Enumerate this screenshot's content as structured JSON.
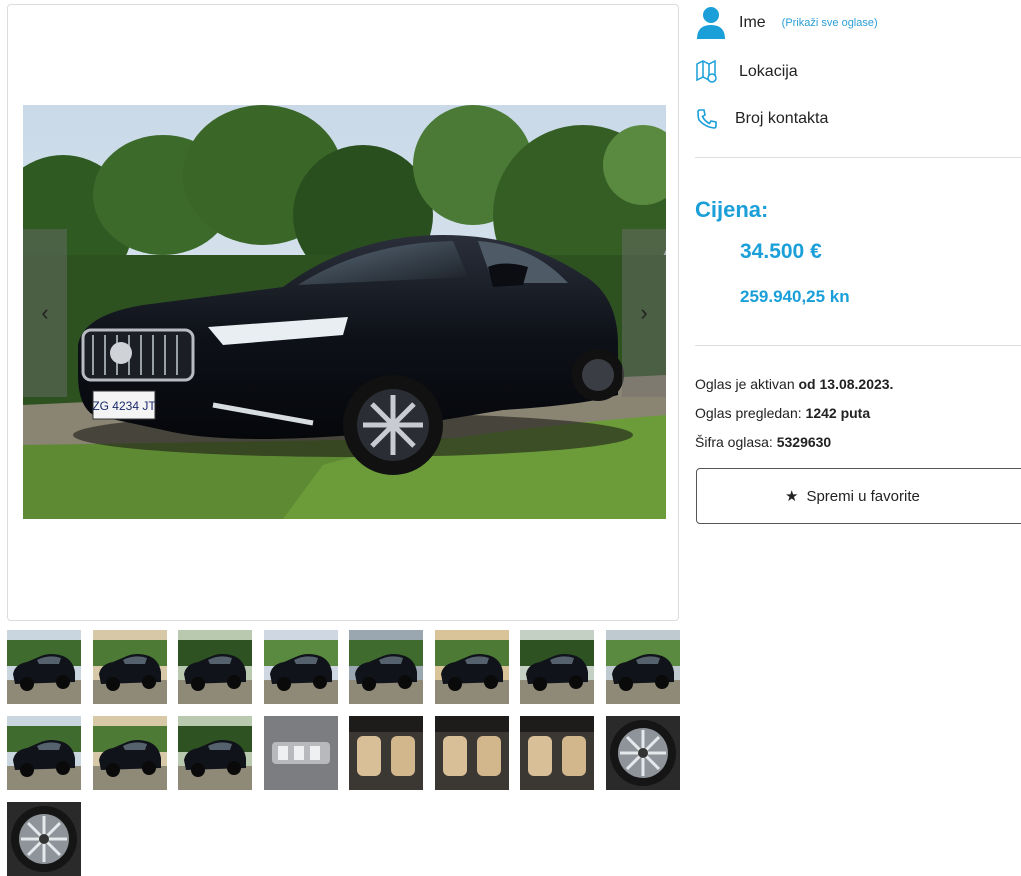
{
  "seller": {
    "name": "Ime",
    "all_ads_link": "(Prikaži sve oglase)",
    "location_label": "Lokacija",
    "phone_label": "Broj kontakta"
  },
  "price": {
    "label": "Cijena:",
    "eur": "34.500 €",
    "kn": "259.940,25 kn"
  },
  "ad": {
    "active_prefix": "Oglas je aktivan ",
    "active_value": "od 13.08.2023.",
    "views_prefix": "Oglas pregledan: ",
    "views_value": "1242 puta",
    "code_prefix": "Šifra oglasa: ",
    "code_value": "5329630"
  },
  "actions": {
    "favorite_label": "Spremi u favorite"
  },
  "gallery": {
    "prev_arrow": "‹",
    "next_arrow": "›",
    "plate_text": "ZG 4234 JT",
    "thumb_count": 17,
    "thumb_kinds": [
      "car",
      "car",
      "car",
      "car",
      "car",
      "car",
      "car",
      "car",
      "car",
      "car",
      "car",
      "badge",
      "interior",
      "interior",
      "interior",
      "wheel",
      "wheel"
    ]
  },
  "colors": {
    "accent": "#1a9fd9",
    "link": "#2a9fd6",
    "car_body": "#0e1118",
    "foliage": "#2f5a22"
  }
}
